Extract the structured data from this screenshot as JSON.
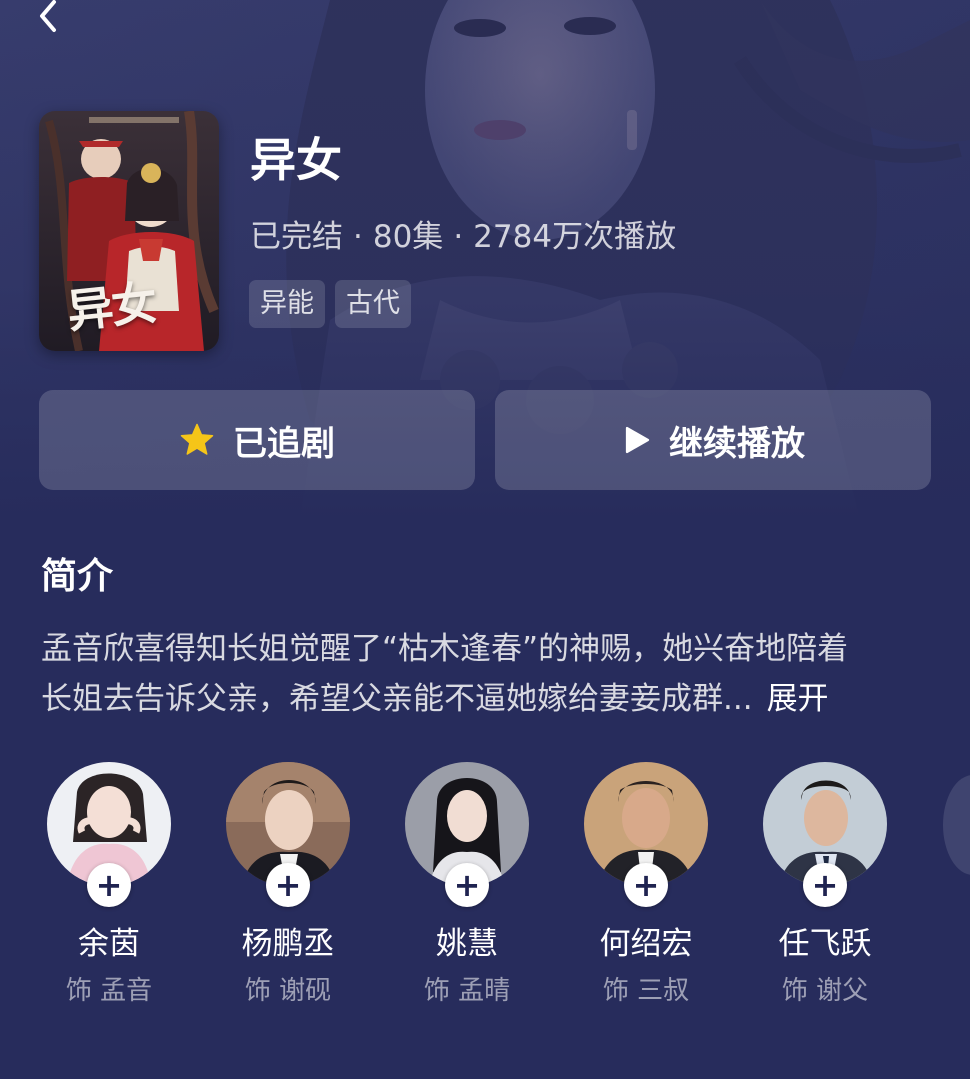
{
  "header": {
    "back_icon": "chevron-left-icon"
  },
  "drama": {
    "title": "异女",
    "poster_title": "异女",
    "status": "已完结",
    "episodes": "80集",
    "plays": "2784万次播放",
    "separator": "·",
    "tags": [
      "异能",
      "古代"
    ]
  },
  "actions": {
    "follow_label": "已追剧",
    "follow_icon": "star-icon",
    "follow_icon_color": "#f5c518",
    "play_label": "继续播放",
    "play_icon": "play-icon"
  },
  "intro": {
    "heading": "简介",
    "line1": "孟音欣喜得知长姐觉醒了“枯木逢春”的神赐，她兴奋地陪着",
    "line2": "长姐去告诉父亲，希望父亲能不逼她嫁给妻妾成群...",
    "expand_label": "展开"
  },
  "cast": [
    {
      "name": "余茵",
      "role": "饰 孟音",
      "follow_icon": "plus-icon"
    },
    {
      "name": "杨鹏丞",
      "role": "饰 谢砚",
      "follow_icon": "plus-icon"
    },
    {
      "name": "姚慧",
      "role": "饰 孟晴",
      "follow_icon": "plus-icon"
    },
    {
      "name": "何绍宏",
      "role": "饰 三叔",
      "follow_icon": "plus-icon"
    },
    {
      "name": "任飞跃",
      "role": "饰 谢父",
      "follow_icon": "plus-icon"
    }
  ],
  "colors": {
    "background": "#272c5c",
    "button_bg": "rgba(255,255,255,0.17)",
    "tag_bg": "rgba(255,255,255,0.14)"
  }
}
